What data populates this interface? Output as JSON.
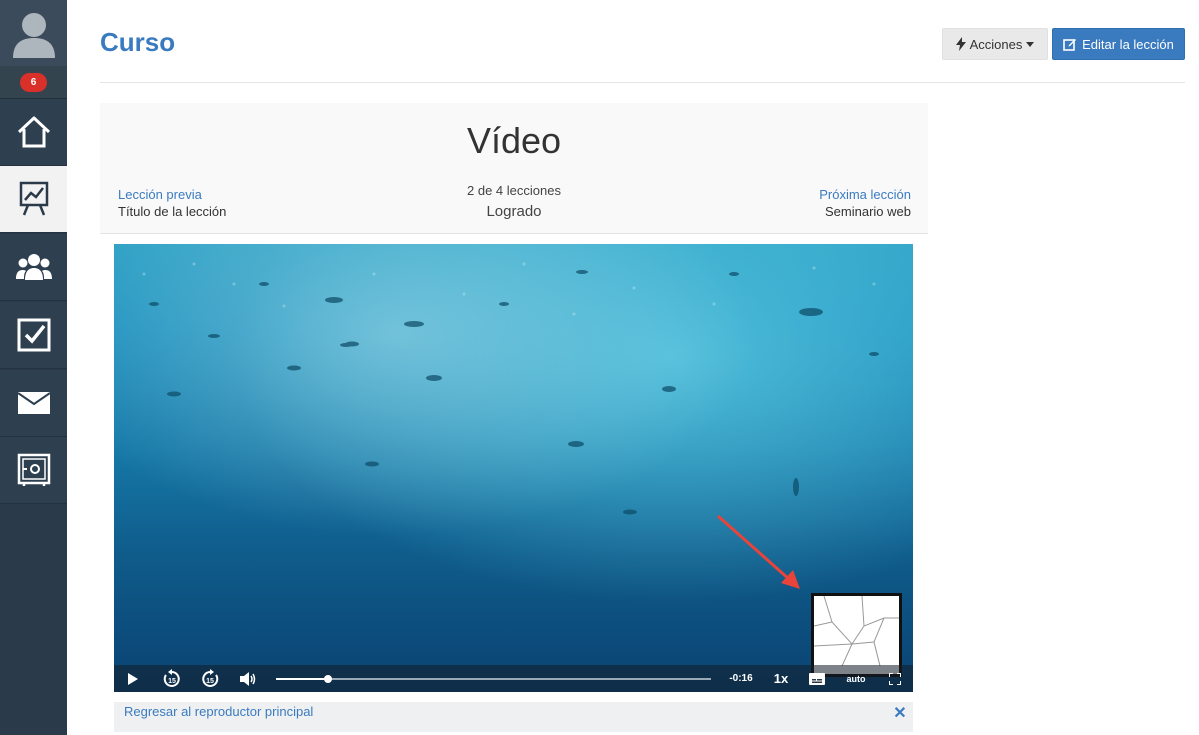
{
  "sidebar": {
    "notification_count": "6",
    "items": [
      {
        "icon": "home-icon"
      },
      {
        "icon": "chart-presentation-icon",
        "active": true
      },
      {
        "icon": "users-icon"
      },
      {
        "icon": "checkbox-icon"
      },
      {
        "icon": "envelope-icon"
      },
      {
        "icon": "safe-icon"
      }
    ]
  },
  "header": {
    "title": "Curso",
    "actions_label": "Acciones",
    "edit_label": "Editar la lección"
  },
  "lesson": {
    "title": "Vídeo",
    "prev_label": "Lección previa",
    "prev_title": "Título de la lección",
    "count": "2 de 4 lecciones",
    "status": "Logrado",
    "next_label": "Próxima lección",
    "next_title": "Seminario web"
  },
  "player": {
    "progress": 0.12,
    "time_remaining": "-0:16",
    "speed": "1x",
    "quality": "auto",
    "rewind_seconds": "15",
    "forward_seconds": "15"
  },
  "return_bar": {
    "label": "Regresar al reproductor principal"
  },
  "colors": {
    "accent": "#3a7bbf",
    "sidebar": "#2b3a4a",
    "badge": "#d9312a",
    "annotation_arrow": "#e8443a"
  }
}
